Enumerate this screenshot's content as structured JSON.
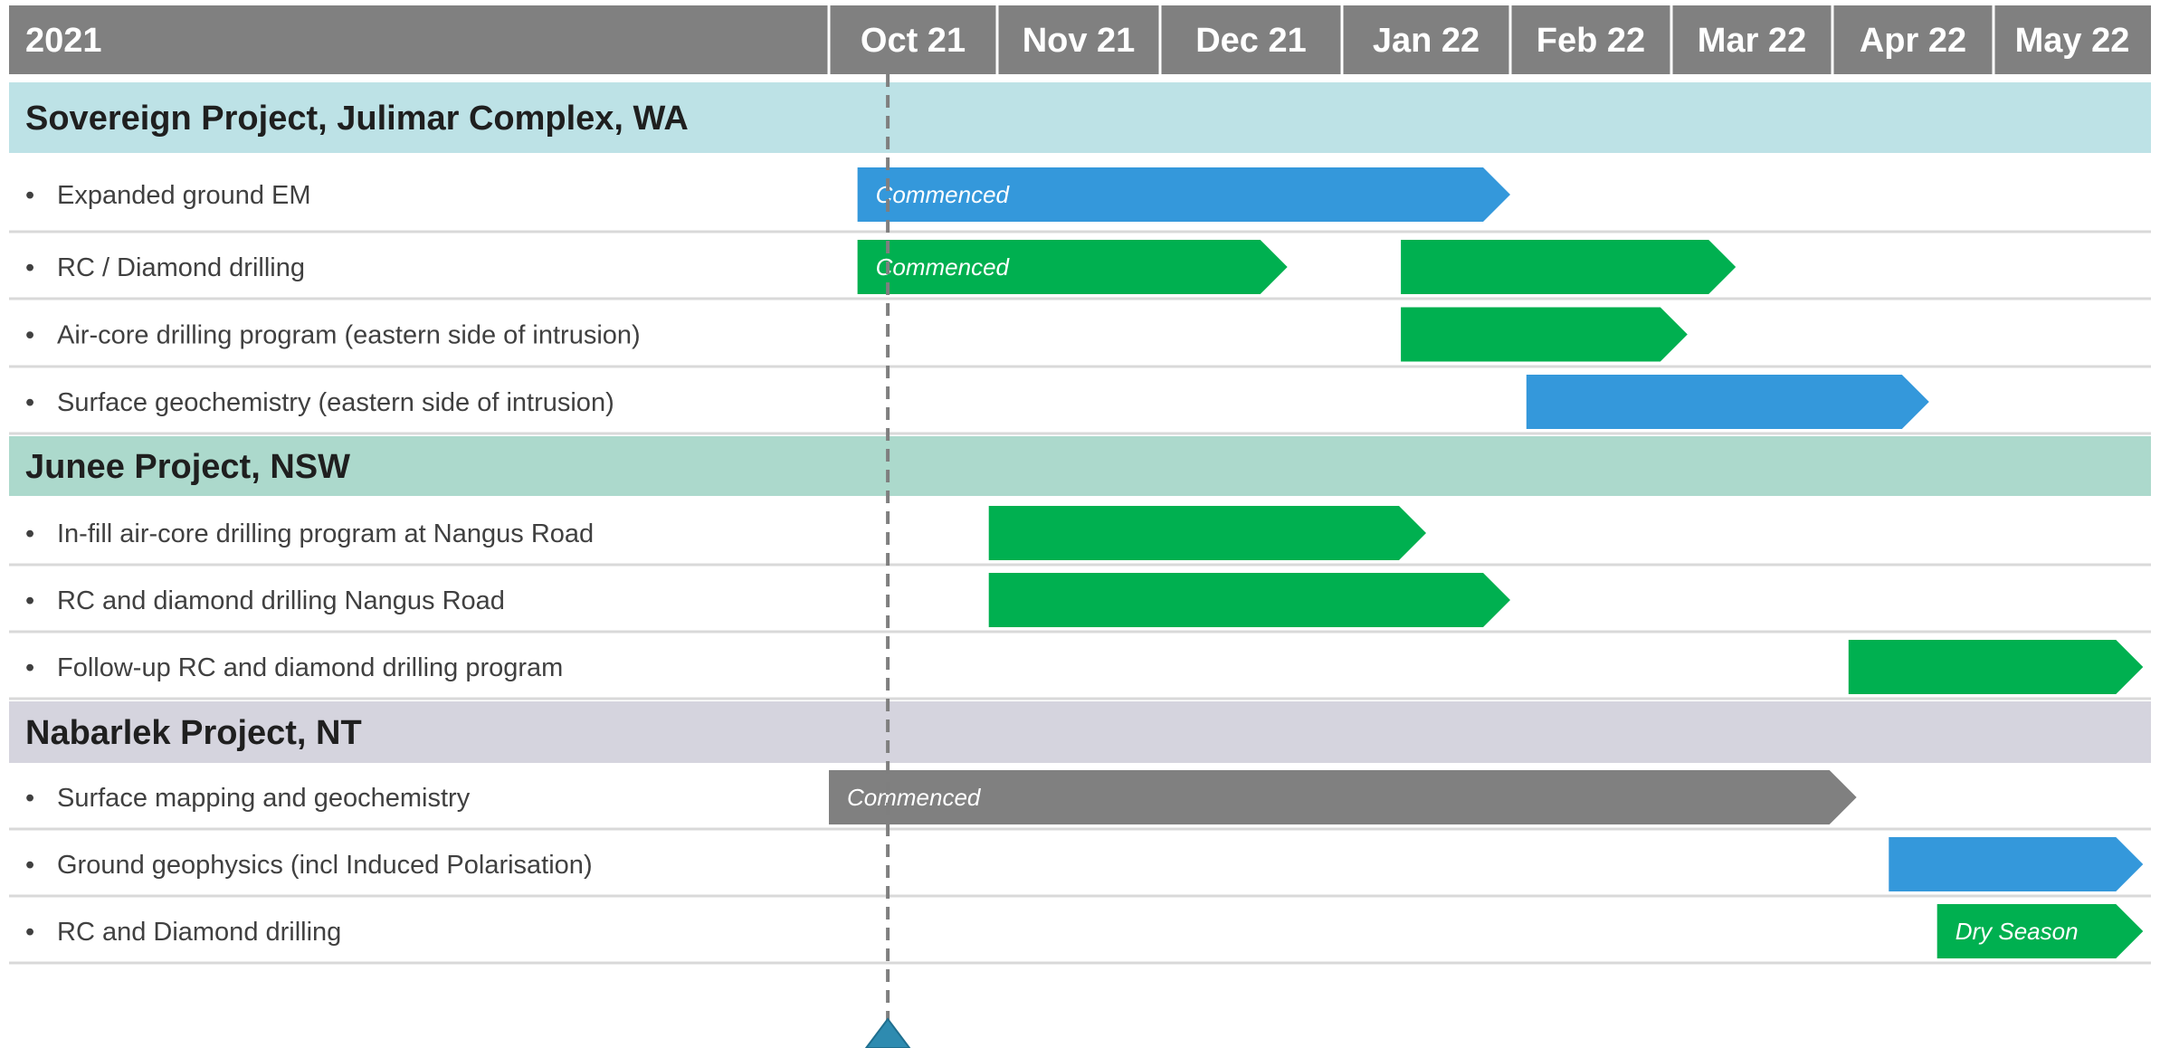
{
  "chart_data": {
    "type": "gantt",
    "year_label": "2021",
    "months": [
      "Oct 21",
      "Nov 21",
      "Dec 21",
      "Jan 22",
      "Feb 22",
      "Mar 22",
      "Apr 22",
      "May 22"
    ],
    "today_marker": 0.35,
    "colors": {
      "header": "#808080",
      "green": "#00b050",
      "blue": "#3498db",
      "grey": "#808080",
      "marker": "#2e8bb0"
    },
    "sections": [
      {
        "title": "Sovereign Project, Julimar Complex, WA",
        "color": "#bde2e6",
        "tasks": [
          {
            "label": "Expanded ground EM",
            "bars": [
              {
                "start": 0.17,
                "end": 4.0,
                "color": "blue",
                "text": "Commenced"
              }
            ]
          },
          {
            "label": "RC / Diamond drilling",
            "bars": [
              {
                "start": 0.17,
                "end": 2.7,
                "color": "green",
                "text": "Commenced"
              },
              {
                "start": 3.35,
                "end": 5.4,
                "color": "green",
                "text": ""
              }
            ]
          },
          {
            "label": "Air-core drilling program (eastern side of intrusion)",
            "bars": [
              {
                "start": 3.35,
                "end": 5.1,
                "color": "green",
                "text": ""
              }
            ]
          },
          {
            "label": "Surface geochemistry (eastern side of intrusion)",
            "bars": [
              {
                "start": 4.1,
                "end": 6.6,
                "color": "blue",
                "text": ""
              }
            ]
          }
        ]
      },
      {
        "title": "Junee Project, NSW",
        "color": "#acd9cc",
        "tasks": [
          {
            "label": "In-fill air-core drilling program at Nangus Road",
            "bars": [
              {
                "start": 0.95,
                "end": 3.5,
                "color": "green",
                "text": ""
              }
            ]
          },
          {
            "label": "RC and diamond drilling Nangus Road",
            "bars": [
              {
                "start": 0.95,
                "end": 4.0,
                "color": "green",
                "text": ""
              }
            ]
          },
          {
            "label": "Follow-up RC and diamond drilling program",
            "bars": [
              {
                "start": 6.1,
                "end": 7.95,
                "color": "green",
                "text": ""
              }
            ]
          }
        ]
      },
      {
        "title": "Nabarlek Project, NT",
        "color": "#d5d4de",
        "tasks": [
          {
            "label": "Surface mapping and geochemistry",
            "bars": [
              {
                "start": 0.0,
                "end": 6.15,
                "color": "grey",
                "text": "Commenced"
              }
            ]
          },
          {
            "label": "Ground geophysics (incl Induced Polarisation)",
            "bars": [
              {
                "start": 6.35,
                "end": 7.95,
                "color": "blue",
                "text": ""
              }
            ]
          },
          {
            "label": "RC and Diamond drilling",
            "bars": [
              {
                "start": 6.65,
                "end": 7.95,
                "color": "green",
                "text": "Dry Season"
              }
            ]
          }
        ]
      }
    ]
  }
}
